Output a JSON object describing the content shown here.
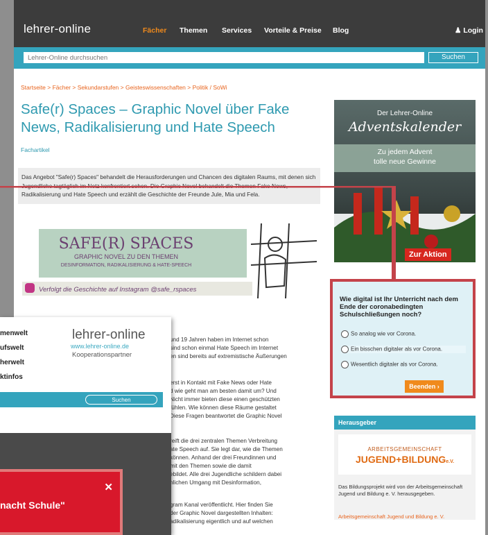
{
  "nav": {
    "logo": "lehrer-online",
    "items": [
      "Fächer",
      "Themen",
      "Services",
      "Vorteile & Preise",
      "Blog"
    ],
    "login": "Login"
  },
  "search": {
    "placeholder": "Lehrer-Online durchsuchen",
    "button": "Suchen"
  },
  "breadcrumb": "Startseite > Fächer > Sekundarstufen > Geisteswissenschaften > Politik / SoWi",
  "title": "Safe(r) Spaces – Graphic Novel über Fake News, Radikalisierung und Hate Speech",
  "category": "Fachartikel",
  "teaser": "Das Angebot \"Safe(r) Spaces\" behandelt die Herausforderungen und Chancen des digitalen Raums, mit denen sich Jugendliche tagtäglich im Netz konfrontiert sehen. Die Graphic Novel behandelt die Themen Fake News, Radikalisierung und Hate Speech und erzählt die Geschichte der Freunde Jule, Mia und Fela.",
  "banner": {
    "title": "SAFE(R) SPACES",
    "subtitle": "GRAPHIC NOVEL ZU DEN THEMEN",
    "themes": "DESINFORMATION, RADIKALISIERUNG & HATE-SPEECH",
    "instagram": "Verfolgt die Geschichte auf Instagram @safe_rspaces"
  },
  "body": [
    "und 19 Jahren haben im Internet schon",
    "sind schon einmal Hate Speech im Internet",
    "en sind bereits auf extremistische Äußerungen",
    "erst in Kontakt mit Fake News oder Hate",
    "d wie geht man am besten damit um? Und",
    "Nicht immer bieten diese einen geschützten",
    "fühlen. Wie können diese Räume gestaltet",
    "Diese Fragen beantwortet die Graphic Novel",
    "reift die drei zentralen Themen Verbreitung",
    "ate Speech auf. Sie legt dar, wie die Themen",
    "können. Anhand der drei Freundinnen und",
    "mit den Themen sowie die damit",
    "ebildet. Alle drei Jugendliche schildern dabei",
    "nlichen Umgang mit Desinformation,",
    "gram Kanal veröffentlicht. Hier finden Sie",
    "der Graphic Novel dargestellten Inhalten:",
    "adikalisierung eigentlich und auf welchen"
  ],
  "advent": {
    "line1": "Der Lehrer-Online",
    "line2": "Adventskalender",
    "line3": "Zu jedem Advent",
    "line4": "tolle neue Gewinne",
    "button": "Zur Aktion"
  },
  "poll": {
    "question": "Wie digital ist Ihr Unterricht nach dem Ende der coronabedingten Schulschließungen noch?",
    "options": [
      "So analog wie vor Corona.",
      "Ein bisschen digitaler als vor Corona.",
      "Wesentlich digitaler als vor Corona."
    ],
    "button": "Beenden"
  },
  "publisher": {
    "heading": "Herausgeber",
    "logo_top": "ARBEITSGEMEINSCHAFT",
    "logo_main": "JUGEND+BILDUNG",
    "logo_suffix": "e.V.",
    "text": "Das Bildungsprojekt wird von der Arbeitsgemeinschaft Jugend und Bildung e. V. herausgegeben.",
    "link": "Arbeitsgemeinschaft Jugend und Bildung e. V."
  },
  "overlay": {
    "nav": [
      "menwelt",
      "ufswelt",
      "herwelt",
      "ktinfos"
    ],
    "logo": "lehrer-online",
    "url": "www.lehrer-online.de",
    "partner": "Kooperationspartner",
    "search_button": "Suchen",
    "popup_text": "nacht Schule\""
  },
  "colors": {
    "accent": "#34a4bd",
    "orange": "#f08a1c",
    "highlight": "#c4434a"
  }
}
